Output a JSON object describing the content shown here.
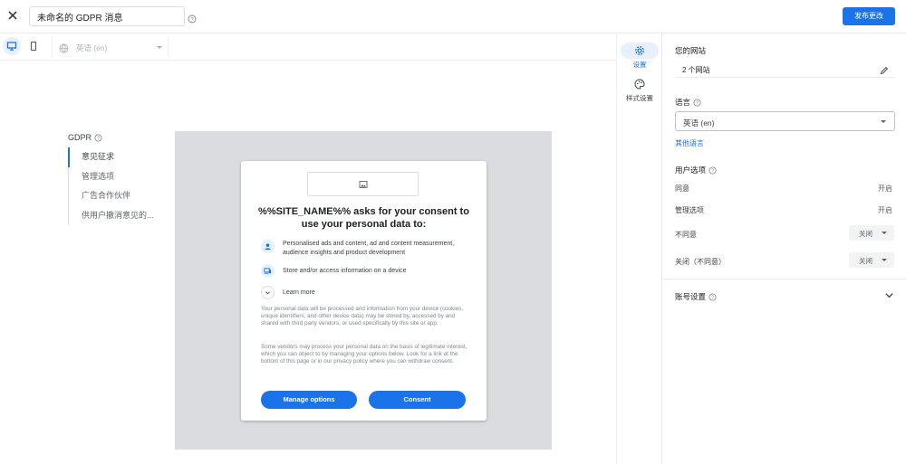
{
  "header": {
    "title_value": "未命名的 GDPR 消息",
    "publish_label": "发布更改"
  },
  "toolbar": {
    "language_value": "英语 (en)"
  },
  "nav": {
    "title": "GDPR",
    "items": [
      {
        "label": "意见征求"
      },
      {
        "label": "管理选项"
      },
      {
        "label": "广告合作伙伴"
      },
      {
        "label": "供用户撤消意见的..."
      }
    ]
  },
  "preview": {
    "title": "%%SITE_NAME%% asks for your consent to use your personal data to:",
    "purposes": [
      {
        "text": "Personalised ads and content, ad and content measurement, audience insights and product development",
        "icon": "person-icon"
      },
      {
        "text": "Store and/or access information on a device",
        "icon": "device-icon"
      }
    ],
    "learn_more": "Learn more",
    "paragraph1": "Your personal data will be processed and information from your device (cookies, unique identifiers, and other device data) may be stored by, accessed by and shared with third party vendors, or used specifically by this site or app.",
    "paragraph2": "Some vendors may process your personal data on the basis of legitimate interest, which you can object to by managing your options below. Look for a link at the bottom of this page or in our privacy policy where you can withdraw consent.",
    "manage_label": "Manage options",
    "consent_label": "Consent"
  },
  "rail": {
    "settings_label": "设置",
    "style_label": "样式设置"
  },
  "panel": {
    "sites_label": "您的网站",
    "sites_value": "2 个网站",
    "language_label": "语言",
    "language_value": "英语 (en)",
    "more_languages": "其他语言",
    "user_choices_label": "用户选项",
    "choices": [
      {
        "label": "同意",
        "value": "开启"
      },
      {
        "label": "管理选项",
        "value": "开启"
      }
    ],
    "dropdown_choices": [
      {
        "label": "不同意",
        "value": "关闭"
      },
      {
        "label": "关闭（不同意）",
        "value": "关闭"
      }
    ],
    "account_settings_label": "账号设置"
  },
  "colors": {
    "primary": "#1a73e8",
    "preview_bg": "#dadce0",
    "active_tint": "#e8f0fe"
  }
}
